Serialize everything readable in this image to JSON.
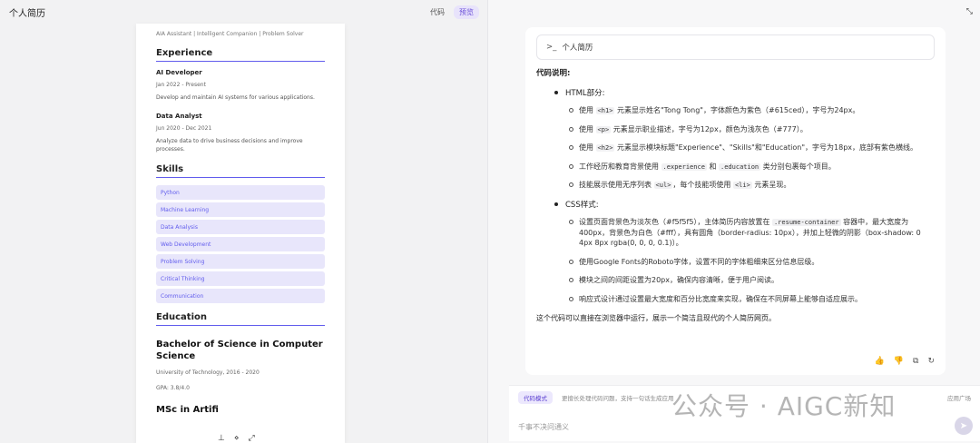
{
  "left": {
    "title": "个人简历",
    "tabs": [
      "代码",
      "预览"
    ],
    "resume": {
      "tagline": "AIA Assistant | Intelligent Companion | Problem Solver",
      "experience_title": "Experience",
      "jobs": [
        {
          "title": "AI Developer",
          "date": "Jan 2022 - Present",
          "desc": "Develop and maintain AI systems for various applications."
        },
        {
          "title": "Data Analyst",
          "date": "Jun 2020 - Dec 2021",
          "desc": "Analyze data to drive business decisions and improve processes."
        }
      ],
      "skills_title": "Skills",
      "skills": [
        "Python",
        "Machine Learning",
        "Data Analysis",
        "Web Development",
        "Problem Solving",
        "Critical Thinking",
        "Communication"
      ],
      "education_title": "Education",
      "education": [
        {
          "degree": "Bachelor of Science in Computer Science",
          "meta": "University of Technology, 2016 - 2020",
          "gpa": "GPA: 3.8/4.0"
        },
        {
          "degree": "MSc in Artifi"
        }
      ]
    },
    "float_tools": [
      "⊥",
      "⋄",
      "⤢"
    ]
  },
  "right": {
    "expand_icon": "⤡",
    "file_chip": {
      "chevron": ">_",
      "name": "个人简历"
    },
    "heading": "代码说明:",
    "sections": [
      {
        "label": "HTML部分:",
        "items": [
          [
            "使用 ",
            "<h1>",
            " 元素显示姓名\"Tong Tong\"，字体颜色为紫色（#615ced），字号为24px。"
          ],
          [
            "使用 ",
            "<p>",
            " 元素显示职业描述，字号为12px，颜色为浅灰色（#777）。"
          ],
          [
            "使用 ",
            "<h2>",
            " 元素显示模块标题\"Experience\"、\"Skills\"和\"Education\"，字号为18px，底部有紫色横线。"
          ],
          [
            "工作经历和教育背景使用 ",
            ".experience",
            " 和 ",
            ".education",
            " 类分别包裹每个项目。"
          ],
          [
            "技能展示使用无序列表 ",
            "<ul>",
            "，每个技能项使用 ",
            "<li>",
            " 元素呈现。"
          ]
        ]
      },
      {
        "label": "CSS样式:",
        "items": [
          [
            "设置页面背景色为淡灰色（#f5f5f5），主体简历内容放置在 ",
            ".resume-container",
            " 容器中，最大宽度为400px，背景色为白色（#fff），具有圆角（border-radius: 10px），并加上轻微的阴影（box-shadow: 0 4px 8px rgba(0, 0, 0, 0.1)）。"
          ],
          [
            "使用Google Fonts的Roboto字体，设置不同的字体粗细来区分信息层级。"
          ],
          [
            "模块之间的间距设置为20px，确保内容清晰，便于用户阅读。"
          ],
          [
            "响应式设计通过设置最大宽度和百分比宽度来实现，确保在不同屏幕上能够自适应展示。"
          ]
        ]
      }
    ],
    "summary": "这个代码可以直接在浏览器中运行，展示一个简洁且现代的个人简历网页。",
    "actions": [
      "👍",
      "👎",
      "⧉",
      "↻"
    ],
    "input": {
      "mode_label": "代码模式",
      "mode_hint": "更擅长处理代码问题，支持一句话生成应用",
      "plaza": "应用广场",
      "placeholder": "千事不决问通义",
      "send_icon": "➤"
    },
    "watermark": "公众号 · AIGC新知"
  }
}
